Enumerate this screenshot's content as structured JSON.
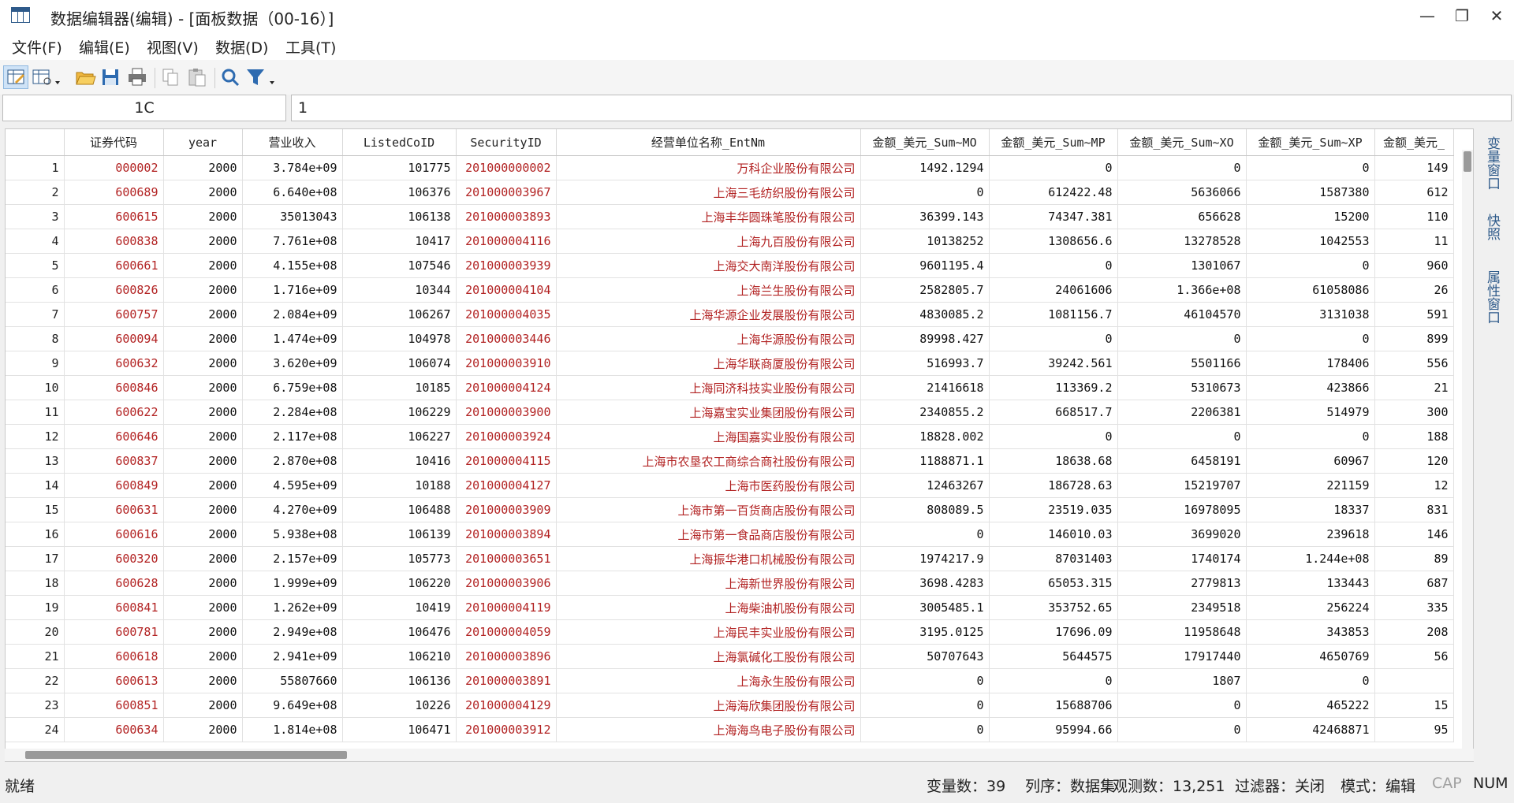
{
  "window": {
    "title": "数据编辑器(编辑) - [面板数据（00-16）]",
    "minimize": "—",
    "restore": "❐",
    "close": "✕"
  },
  "menu": [
    "文件(F)",
    "编辑(E)",
    "视图(V)",
    "数据(D)",
    "工具(T)"
  ],
  "toolbar": {
    "icons": [
      "edit-mode-icon",
      "browse-mode-icon",
      "open-folder-icon",
      "save-icon",
      "print-icon",
      "copy-icon",
      "paste-icon",
      "search-icon",
      "filter-icon"
    ]
  },
  "cell_ref": "1C",
  "cell_value": "1",
  "grid": {
    "columns": [
      "",
      "证券代码",
      "year",
      "营业收入",
      "ListedCoID",
      "SecurityID",
      "经营单位名称_EntNm",
      "金额_美元_Sum~MO",
      "金额_美元_Sum~MP",
      "金额_美元_Sum~XO",
      "金额_美元_Sum~XP",
      "金额_美元_"
    ],
    "string_columns": [
      1,
      5,
      6
    ],
    "rows": [
      [
        "1",
        "000002",
        "2000",
        "3.784e+09",
        "101775",
        "201000000002",
        "万科企业股份有限公司",
        "1492.1294",
        "0",
        "0",
        "0",
        "149"
      ],
      [
        "2",
        "600689",
        "2000",
        "6.640e+08",
        "106376",
        "201000003967",
        "上海三毛纺织股份有限公司",
        "0",
        "612422.48",
        "5636066",
        "1587380",
        "612"
      ],
      [
        "3",
        "600615",
        "2000",
        "35013043",
        "106138",
        "201000003893",
        "上海丰华圆珠笔股份有限公司",
        "36399.143",
        "74347.381",
        "656628",
        "15200",
        "110"
      ],
      [
        "4",
        "600838",
        "2000",
        "7.761e+08",
        "10417",
        "201000004116",
        "上海九百股份有限公司",
        "10138252",
        "1308656.6",
        "13278528",
        "1042553",
        "11"
      ],
      [
        "5",
        "600661",
        "2000",
        "4.155e+08",
        "107546",
        "201000003939",
        "上海交大南洋股份有限公司",
        "9601195.4",
        "0",
        "1301067",
        "0",
        "960"
      ],
      [
        "6",
        "600826",
        "2000",
        "1.716e+09",
        "10344",
        "201000004104",
        "上海兰生股份有限公司",
        "2582805.7",
        "24061606",
        "1.366e+08",
        "61058086",
        "26"
      ],
      [
        "7",
        "600757",
        "2000",
        "2.084e+09",
        "106267",
        "201000004035",
        "上海华源企业发展股份有限公司",
        "4830085.2",
        "1081156.7",
        "46104570",
        "3131038",
        "591"
      ],
      [
        "8",
        "600094",
        "2000",
        "1.474e+09",
        "104978",
        "201000003446",
        "上海华源股份有限公司",
        "89998.427",
        "0",
        "0",
        "0",
        "899"
      ],
      [
        "9",
        "600632",
        "2000",
        "3.620e+09",
        "106074",
        "201000003910",
        "上海华联商厦股份有限公司",
        "516993.7",
        "39242.561",
        "5501166",
        "178406",
        "556"
      ],
      [
        "10",
        "600846",
        "2000",
        "6.759e+08",
        "10185",
        "201000004124",
        "上海同济科技实业股份有限公司",
        "21416618",
        "113369.2",
        "5310673",
        "423866",
        "21"
      ],
      [
        "11",
        "600622",
        "2000",
        "2.284e+08",
        "106229",
        "201000003900",
        "上海嘉宝实业集团股份有限公司",
        "2340855.2",
        "668517.7",
        "2206381",
        "514979",
        "300"
      ],
      [
        "12",
        "600646",
        "2000",
        "2.117e+08",
        "106227",
        "201000003924",
        "上海国嘉实业股份有限公司",
        "18828.002",
        "0",
        "0",
        "0",
        "188"
      ],
      [
        "13",
        "600837",
        "2000",
        "2.870e+08",
        "10416",
        "201000004115",
        "上海市农垦农工商综合商社股份有限公司",
        "1188871.1",
        "18638.68",
        "6458191",
        "60967",
        "120"
      ],
      [
        "14",
        "600849",
        "2000",
        "4.595e+09",
        "10188",
        "201000004127",
        "上海市医药股份有限公司",
        "12463267",
        "186728.63",
        "15219707",
        "221159",
        "12"
      ],
      [
        "15",
        "600631",
        "2000",
        "4.270e+09",
        "106488",
        "201000003909",
        "上海市第一百货商店股份有限公司",
        "808089.5",
        "23519.035",
        "16978095",
        "18337",
        "831"
      ],
      [
        "16",
        "600616",
        "2000",
        "5.938e+08",
        "106139",
        "201000003894",
        "上海市第一食品商店股份有限公司",
        "0",
        "146010.03",
        "3699020",
        "239618",
        "146"
      ],
      [
        "17",
        "600320",
        "2000",
        "2.157e+09",
        "105773",
        "201000003651",
        "上海振华港口机械股份有限公司",
        "1974217.9",
        "87031403",
        "1740174",
        "1.244e+08",
        "89"
      ],
      [
        "18",
        "600628",
        "2000",
        "1.999e+09",
        "106220",
        "201000003906",
        "上海新世界股份有限公司",
        "3698.4283",
        "65053.315",
        "2779813",
        "133443",
        "687"
      ],
      [
        "19",
        "600841",
        "2000",
        "1.262e+09",
        "10419",
        "201000004119",
        "上海柴油机股份有限公司",
        "3005485.1",
        "353752.65",
        "2349518",
        "256224",
        "335"
      ],
      [
        "20",
        "600781",
        "2000",
        "2.949e+08",
        "106476",
        "201000004059",
        "上海民丰实业股份有限公司",
        "3195.0125",
        "17696.09",
        "11958648",
        "343853",
        "208"
      ],
      [
        "21",
        "600618",
        "2000",
        "2.941e+09",
        "106210",
        "201000003896",
        "上海氯碱化工股份有限公司",
        "50707643",
        "5644575",
        "17917440",
        "4650769",
        "56"
      ],
      [
        "22",
        "600613",
        "2000",
        "55807660",
        "106136",
        "201000003891",
        "上海永生股份有限公司",
        "0",
        "0",
        "1807",
        "0",
        ""
      ],
      [
        "23",
        "600851",
        "2000",
        "9.649e+08",
        "10226",
        "201000004129",
        "上海海欣集团股份有限公司",
        "0",
        "15688706",
        "0",
        "465222",
        "15"
      ],
      [
        "24",
        "600634",
        "2000",
        "1.814e+08",
        "106471",
        "201000003912",
        "上海海鸟电子股份有限公司",
        "0",
        "95994.66",
        "0",
        "42468871",
        "95"
      ]
    ]
  },
  "side_tabs": [
    "变量窗口",
    "快照",
    "属性窗口"
  ],
  "status": {
    "ready": "就绪",
    "vars": "变量数：39",
    "order": "列序：数据集",
    "obs": "观测数：13,251",
    "filter": "过滤器：关闭",
    "mode": "模式：编辑",
    "cap": "CAP",
    "num": "NUM"
  }
}
